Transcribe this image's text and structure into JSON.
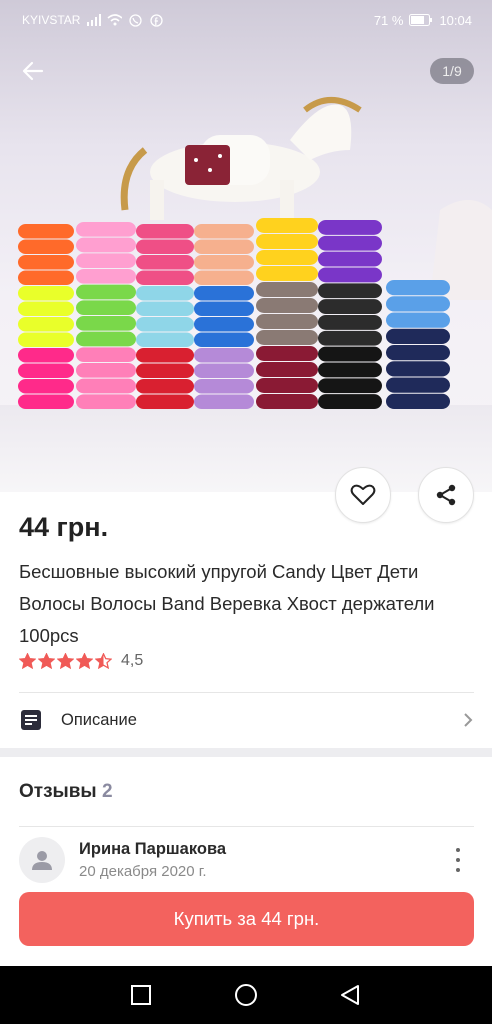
{
  "status_bar": {
    "carrier": "KYIVSTAR",
    "battery": "71 %",
    "time": "10:04"
  },
  "gallery": {
    "counter": "1/9"
  },
  "product": {
    "price": "44 грн.",
    "title": "Бесшовные высокий упругой Candy Цвет Дети Волосы Волосы Band Веревка Хвост держатели 100pcs",
    "rating_value": "4,5",
    "rating_stars": 4.5
  },
  "description": {
    "label": "Описание"
  },
  "reviews": {
    "title": "Отзывы",
    "count": "2",
    "items": [
      {
        "author": "Ирина Паршакова",
        "date": "20 декабря 2020 г."
      }
    ]
  },
  "actions": {
    "buy_label": "Купить за 44 грн."
  },
  "colors": {
    "accent": "#f3625e",
    "star": "#f05a57"
  },
  "icons": {
    "back": "arrow-left-icon",
    "favorite": "heart-icon",
    "share": "share-icon",
    "description": "document-icon",
    "chevron": "chevron-right-icon",
    "avatar": "user-icon",
    "more": "more-vertical-icon"
  }
}
